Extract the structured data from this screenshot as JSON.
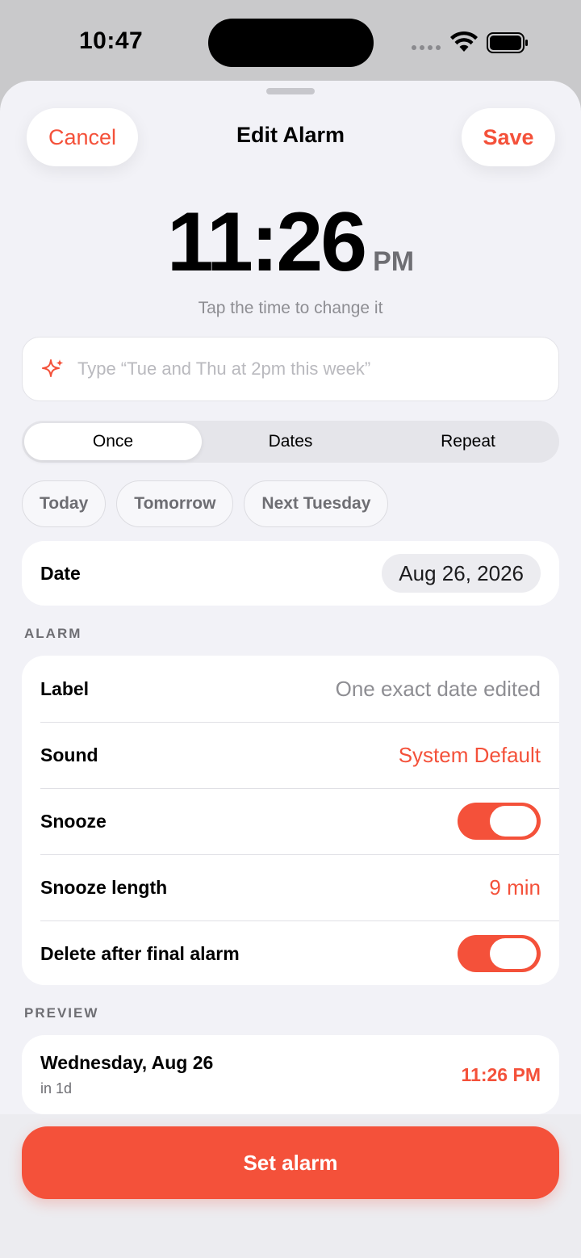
{
  "status_bar": {
    "time": "10:47"
  },
  "header": {
    "cancel_label": "Cancel",
    "title": "Edit Alarm",
    "save_label": "Save"
  },
  "alarm_time": {
    "time": "11:26",
    "period": "PM",
    "hint": "Tap the time to change it"
  },
  "quick_input": {
    "placeholder": "Type “Tue and Thu at 2pm this week”",
    "value": "",
    "icon": "sparkle-icon"
  },
  "schedule_tabs": [
    {
      "label": "Once",
      "active": true
    },
    {
      "label": "Dates",
      "active": false
    },
    {
      "label": "Repeat",
      "active": false
    }
  ],
  "quick_dates": [
    "Today",
    "Tomorrow",
    "Next Tuesday"
  ],
  "date_row": {
    "label": "Date",
    "value": "Aug 26, 2026"
  },
  "alarm_section": {
    "header": "ALARM",
    "label": {
      "label": "Label",
      "value": "One exact date edited"
    },
    "sound": {
      "label": "Sound",
      "value": "System Default"
    },
    "snooze": {
      "label": "Snooze",
      "on": true
    },
    "snooze_length": {
      "label": "Snooze length",
      "value": "9 min"
    },
    "delete_after": {
      "label": "Delete after final alarm",
      "on": true
    }
  },
  "preview": {
    "header": "PREVIEW",
    "date": "Wednesday, Aug 26",
    "relative": "in 1d",
    "time": "11:26 PM"
  },
  "set_alarm_label": "Set alarm",
  "colors": {
    "accent": "#f4513a",
    "background": "#f2f2f7",
    "secondary_text": "#8e8e93"
  }
}
